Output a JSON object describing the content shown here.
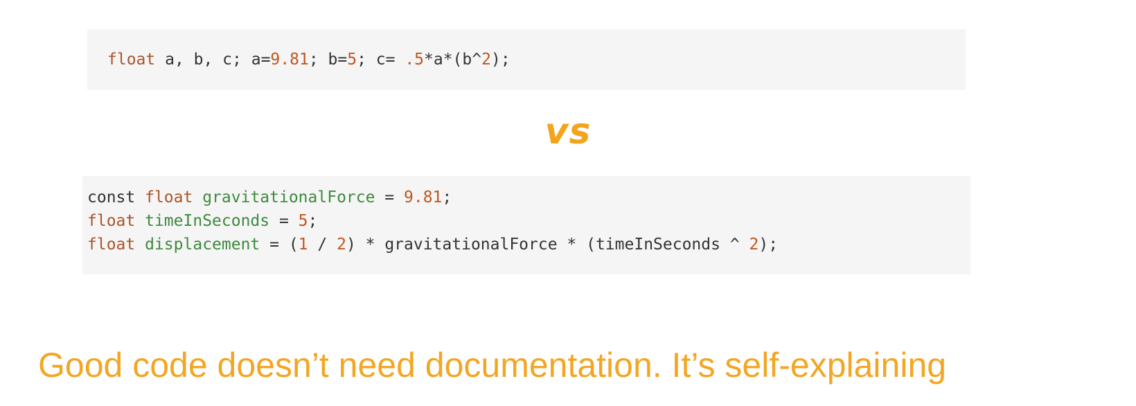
{
  "code_block_1": {
    "lines": [
      [
        {
          "t": "float",
          "k": "kw"
        },
        {
          "t": " a, b, c; a=",
          "k": "plain"
        },
        {
          "t": "9.81",
          "k": "num"
        },
        {
          "t": "; b=",
          "k": "plain"
        },
        {
          "t": "5",
          "k": "num"
        },
        {
          "t": "; c= ",
          "k": "plain"
        },
        {
          "t": ".5",
          "k": "num"
        },
        {
          "t": "*a*(b^",
          "k": "plain"
        },
        {
          "t": "2",
          "k": "num"
        },
        {
          "t": ");",
          "k": "plain"
        }
      ]
    ]
  },
  "separator": {
    "label": "vs"
  },
  "code_block_2": {
    "lines": [
      [
        {
          "t": "const ",
          "k": "plain"
        },
        {
          "t": "float",
          "k": "kw"
        },
        {
          "t": " ",
          "k": "plain"
        },
        {
          "t": "gravitationalForce",
          "k": "ident"
        },
        {
          "t": " = ",
          "k": "plain"
        },
        {
          "t": "9.81",
          "k": "num"
        },
        {
          "t": ";",
          "k": "plain"
        }
      ],
      [
        {
          "t": "float",
          "k": "kw"
        },
        {
          "t": " ",
          "k": "plain"
        },
        {
          "t": "timeInSeconds",
          "k": "ident"
        },
        {
          "t": " = ",
          "k": "plain"
        },
        {
          "t": "5",
          "k": "num"
        },
        {
          "t": ";",
          "k": "plain"
        }
      ],
      [
        {
          "t": "float",
          "k": "kw"
        },
        {
          "t": " ",
          "k": "plain"
        },
        {
          "t": "displacement",
          "k": "ident"
        },
        {
          "t": " = (",
          "k": "plain"
        },
        {
          "t": "1",
          "k": "num"
        },
        {
          "t": " / ",
          "k": "plain"
        },
        {
          "t": "2",
          "k": "num"
        },
        {
          "t": ") * gravitationalForce * (timeInSeconds ^ ",
          "k": "plain"
        },
        {
          "t": "2",
          "k": "num"
        },
        {
          "t": ");",
          "k": "plain"
        }
      ]
    ]
  },
  "tagline": {
    "text": "Good code doesn’t need documentation. It’s self-explaining"
  },
  "colors": {
    "accent": "#f3a41b",
    "code_background": "#f5f5f5",
    "keyword": "#a9562a",
    "number": "#c0561f",
    "identifier": "#3d8a3d",
    "plain": "#333333"
  }
}
